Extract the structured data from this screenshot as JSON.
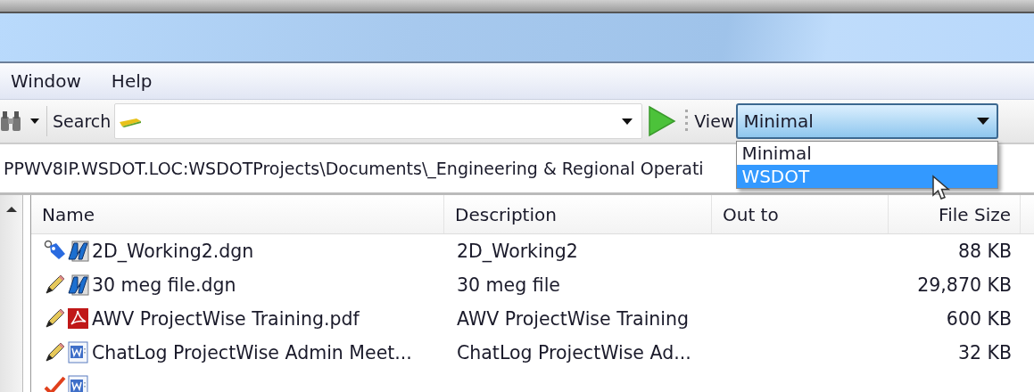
{
  "menu": [
    {
      "label": "Window"
    },
    {
      "label": "Help"
    }
  ],
  "toolbar": {
    "search_label": "Search",
    "view_label": "View",
    "view": {
      "value": "Minimal",
      "open": true,
      "options": [
        {
          "label": "Minimal",
          "highlighted": false
        },
        {
          "label": "WSDOT",
          "highlighted": true
        }
      ]
    }
  },
  "address": "PPWV8IP.WSDOT.LOC:WSDOTProjects\\Documents\\_Engineering & Regional Operati",
  "table": {
    "columns": [
      "Name",
      "Description",
      "Out to",
      "File Size"
    ],
    "rows": [
      {
        "icons": [
          {
            "kind": "tag"
          },
          {
            "kind": "dgn"
          }
        ],
        "name": "2D_Working2.dgn",
        "description": "2D_Working2",
        "size": "88 KB"
      },
      {
        "icons": [
          {
            "kind": "pencil"
          },
          {
            "kind": "dgn"
          }
        ],
        "name": "30 meg file.dgn",
        "description": "30 meg file",
        "size": "29,870 KB"
      },
      {
        "icons": [
          {
            "kind": "pencil"
          },
          {
            "kind": "pdf"
          }
        ],
        "name": "AWV ProjectWise Training.pdf",
        "description": "AWV ProjectWise Training",
        "size": "600 KB"
      },
      {
        "icons": [
          {
            "kind": "pencil"
          },
          {
            "kind": "doc"
          }
        ],
        "name": "ChatLog ProjectWise Admin Meet...",
        "description": "ChatLog ProjectWise Ad...",
        "size": "32 KB"
      },
      {
        "icons": [
          {
            "kind": "check"
          },
          {
            "kind": "doc"
          }
        ]
      }
    ]
  }
}
